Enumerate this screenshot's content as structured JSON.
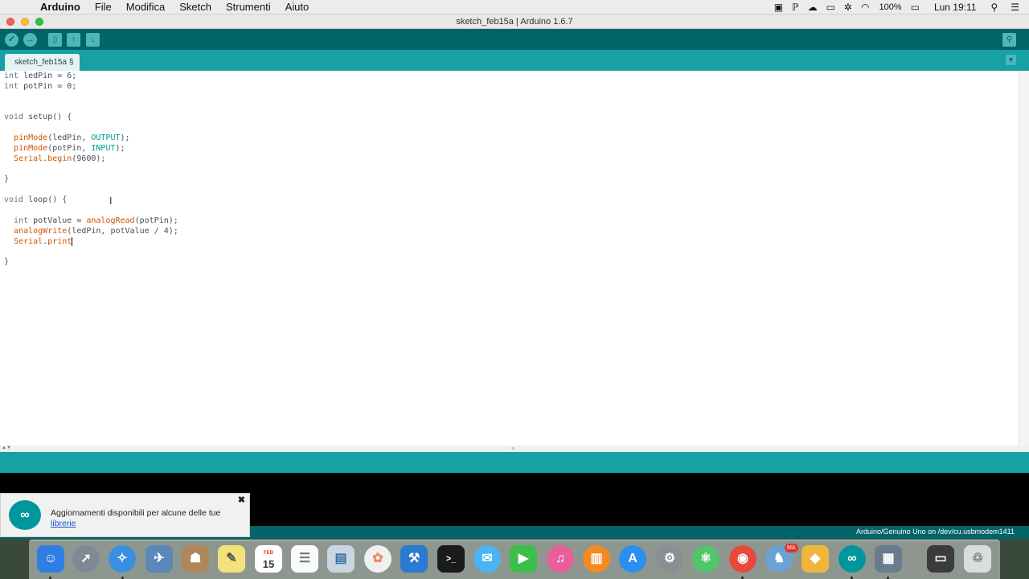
{
  "menubar": {
    "app_name": "Arduino",
    "items": [
      "File",
      "Modifica",
      "Sketch",
      "Strumenti",
      "Aiuto"
    ],
    "battery": "100%",
    "clock": "Lun 19:11"
  },
  "window": {
    "title": "sketch_feb15a | Arduino 1.6.7"
  },
  "toolbar": {
    "buttons": [
      "verify-icon",
      "upload-icon",
      "new-icon",
      "open-icon",
      "save-icon",
      "serial-monitor-icon"
    ]
  },
  "tabs": {
    "active": "sketch_feb15a §"
  },
  "editor": {
    "lines": [
      "int ledPin = 6;",
      "int potPin = 0;",
      "",
      "",
      "void setup() {",
      "",
      "  pinMode(ledPin, OUTPUT);",
      "  pinMode(potPin, INPUT);",
      "  Serial.begin(9600);",
      "",
      "}",
      "",
      "void loop() {",
      "",
      "  int potValue = analogRead(potPin);",
      "  analogWrite(ledPin, potValue / 4);",
      "  Serial.print",
      "",
      "}"
    ]
  },
  "notification": {
    "message": "Aggiornamenti disponibili per alcune delle tue",
    "link": "librerie",
    "close": "✖"
  },
  "status": {
    "board": "Arduino/Genuino Uno on /dev/cu.usbmodem1411"
  },
  "dock": {
    "apps": [
      "finder-icon",
      "launchpad-icon",
      "safari-icon",
      "preview-icon",
      "contacts-icon",
      "notes-icon",
      "calendar-icon",
      "reminders-icon",
      "keynote-icon",
      "photos-icon",
      "xcode-icon",
      "terminal-icon",
      "messages-icon",
      "facetime-icon",
      "itunes-icon",
      "ibooks-icon",
      "app-store-icon",
      "system-preferences-icon",
      "atom-icon",
      "chrome-icon",
      "evernote-icon",
      "sketch-icon",
      "arduino-icon",
      "photo-slideshow-icon",
      "screenshot-folder-icon",
      "trash-icon"
    ],
    "calendar_day": "15",
    "calendar_month": "FEB",
    "evernote_badge": "MA",
    "terminal_prompt": ">_"
  }
}
